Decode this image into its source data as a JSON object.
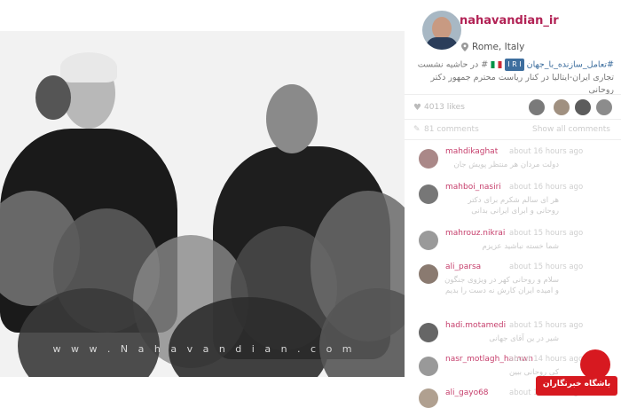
{
  "profile": {
    "username": "nahavandian_ir",
    "location": "Rome, Italy"
  },
  "caption": {
    "hashtag1": "#تعامل_سازنده_با_جهان",
    "line1_rest": "# در حاشیه نشست",
    "line2": "تجاری ایران-ایتالیا در کنار ریاست محترم جمهور دکتر روحانی"
  },
  "photo": {
    "watermark": "w w w . N a h a v a n d i a n . c o m"
  },
  "likes": {
    "count": "4013 likes"
  },
  "comments_bar": {
    "count": "81 comments",
    "view_all": "Show all comments"
  },
  "comments": [
    {
      "user": "mahdikaghat",
      "time": "about 16 hours ago",
      "text": "دولت مردان هر منتظر پویش جان"
    },
    {
      "user": "mahboi_nasiri",
      "time": "about 16 hours ago",
      "text": "هر ای سالم شکرم برای دکتر روحانی و ابرای ایرانی بدانی"
    },
    {
      "user": "mahrouz.nikrai",
      "time": "about 15 hours ago",
      "text": "شما خسته نباشید عزیزم"
    },
    {
      "user": "ali_parsa",
      "time": "about 15 hours ago",
      "text": "سلام و روحانی کهر در ویژوی جنگون و امیده ایران کارش نه دست را بدیم"
    },
    {
      "user": "hadi.motamedi",
      "time": "about 15 hours ago",
      "text": "شیر در ین آقای جهانی"
    },
    {
      "user": "nasr_motlagh_hamwn",
      "time": "about 14 hours ago",
      "text": "کی روحانی ببین"
    },
    {
      "user": "ali_gayo68",
      "time": "about 14 hours ago",
      "text": ""
    }
  ],
  "logo": {
    "text": "باشگاه خبرنگاران"
  },
  "colors": {
    "username": "#b22255",
    "hashtag": "#3d6e9e",
    "comment_user": "#c63f6c",
    "logo_red": "#d71920"
  }
}
